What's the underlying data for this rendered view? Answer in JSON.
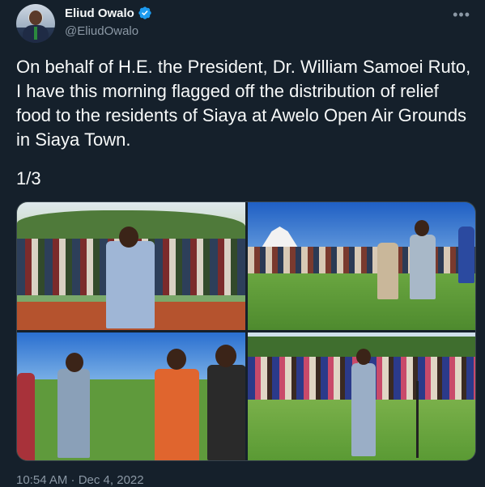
{
  "author": {
    "display_name": "Eliud Owalo",
    "handle": "@EliudOwalo",
    "verified": true
  },
  "tweet": {
    "text": "On behalf of H.E. the President, Dr. William Samoei Ruto, I have this morning flagged off the distribution of relief food to the residents of Siaya at Awelo Open Air Grounds in Siaya Town.",
    "thread_count": "1/3",
    "timestamp": "10:54 AM · Dec 4, 2022"
  },
  "media": {
    "count": 4
  },
  "icons": {
    "more": "more-options-icon",
    "verified": "verified-badge-icon"
  },
  "colors": {
    "background": "#15202b",
    "text_primary": "#f7f9f9",
    "text_secondary": "#8b98a5",
    "verified_blue": "#1d9bf0"
  }
}
